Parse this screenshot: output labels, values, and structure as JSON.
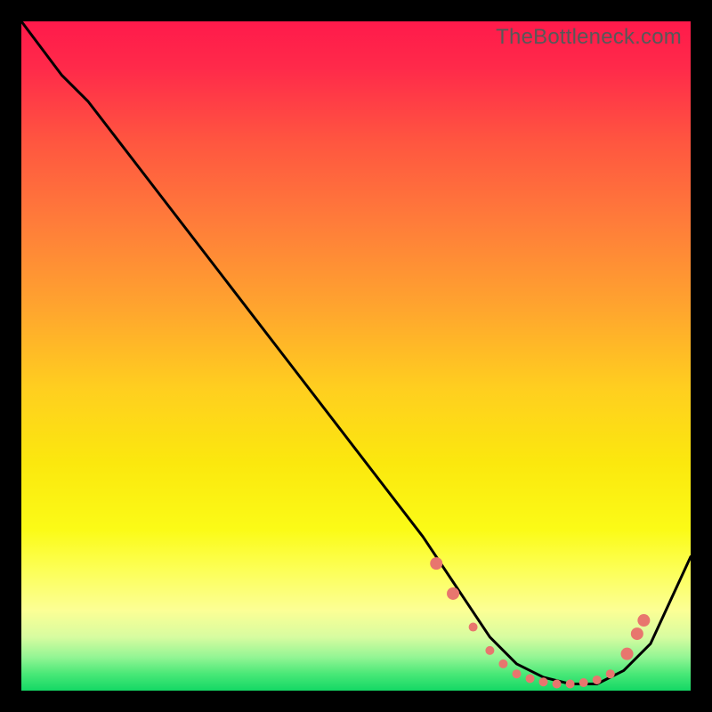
{
  "attribution": "TheBottleneck.com",
  "gradient_stops": [
    {
      "offset": 0.0,
      "color": "#ff1a4b"
    },
    {
      "offset": 0.07,
      "color": "#ff2a4a"
    },
    {
      "offset": 0.18,
      "color": "#ff5640"
    },
    {
      "offset": 0.3,
      "color": "#ff7c3a"
    },
    {
      "offset": 0.42,
      "color": "#ffa22f"
    },
    {
      "offset": 0.55,
      "color": "#ffcf1f"
    },
    {
      "offset": 0.66,
      "color": "#fbe80e"
    },
    {
      "offset": 0.76,
      "color": "#fbfb17"
    },
    {
      "offset": 0.82,
      "color": "#fcff57"
    },
    {
      "offset": 0.88,
      "color": "#fcff95"
    },
    {
      "offset": 0.92,
      "color": "#d7fca0"
    },
    {
      "offset": 0.95,
      "color": "#93f594"
    },
    {
      "offset": 0.975,
      "color": "#49e877"
    },
    {
      "offset": 1.0,
      "color": "#14d865"
    }
  ],
  "chart_data": {
    "type": "line",
    "title": "",
    "xlabel": "",
    "ylabel": "",
    "xlim": [
      0,
      100
    ],
    "ylim": [
      0,
      100
    ],
    "series": [
      {
        "name": "bottleneck-curve",
        "x": [
          0,
          6,
          10,
          20,
          30,
          40,
          50,
          60,
          66,
          70,
          74,
          78,
          82,
          86,
          90,
          94,
          100
        ],
        "y": [
          100,
          92,
          88,
          75,
          62,
          49,
          36,
          23,
          14,
          8,
          4,
          2,
          1,
          1,
          3,
          7,
          20
        ]
      }
    ],
    "markers": {
      "name": "highlight-dots",
      "color": "#e8766e",
      "radius_small": 5,
      "radius_large": 7,
      "points": [
        {
          "x": 62.0,
          "y": 19.0,
          "r": "large"
        },
        {
          "x": 64.5,
          "y": 14.5,
          "r": "large"
        },
        {
          "x": 67.5,
          "y": 9.5,
          "r": "small"
        },
        {
          "x": 70.0,
          "y": 6.0,
          "r": "small"
        },
        {
          "x": 72.0,
          "y": 4.0,
          "r": "small"
        },
        {
          "x": 74.0,
          "y": 2.5,
          "r": "small"
        },
        {
          "x": 76.0,
          "y": 1.8,
          "r": "small"
        },
        {
          "x": 78.0,
          "y": 1.3,
          "r": "small"
        },
        {
          "x": 80.0,
          "y": 1.0,
          "r": "small"
        },
        {
          "x": 82.0,
          "y": 1.0,
          "r": "small"
        },
        {
          "x": 84.0,
          "y": 1.2,
          "r": "small"
        },
        {
          "x": 86.0,
          "y": 1.6,
          "r": "small"
        },
        {
          "x": 88.0,
          "y": 2.5,
          "r": "small"
        },
        {
          "x": 90.5,
          "y": 5.5,
          "r": "large"
        },
        {
          "x": 92.0,
          "y": 8.5,
          "r": "large"
        },
        {
          "x": 93.0,
          "y": 10.5,
          "r": "large"
        }
      ]
    }
  }
}
